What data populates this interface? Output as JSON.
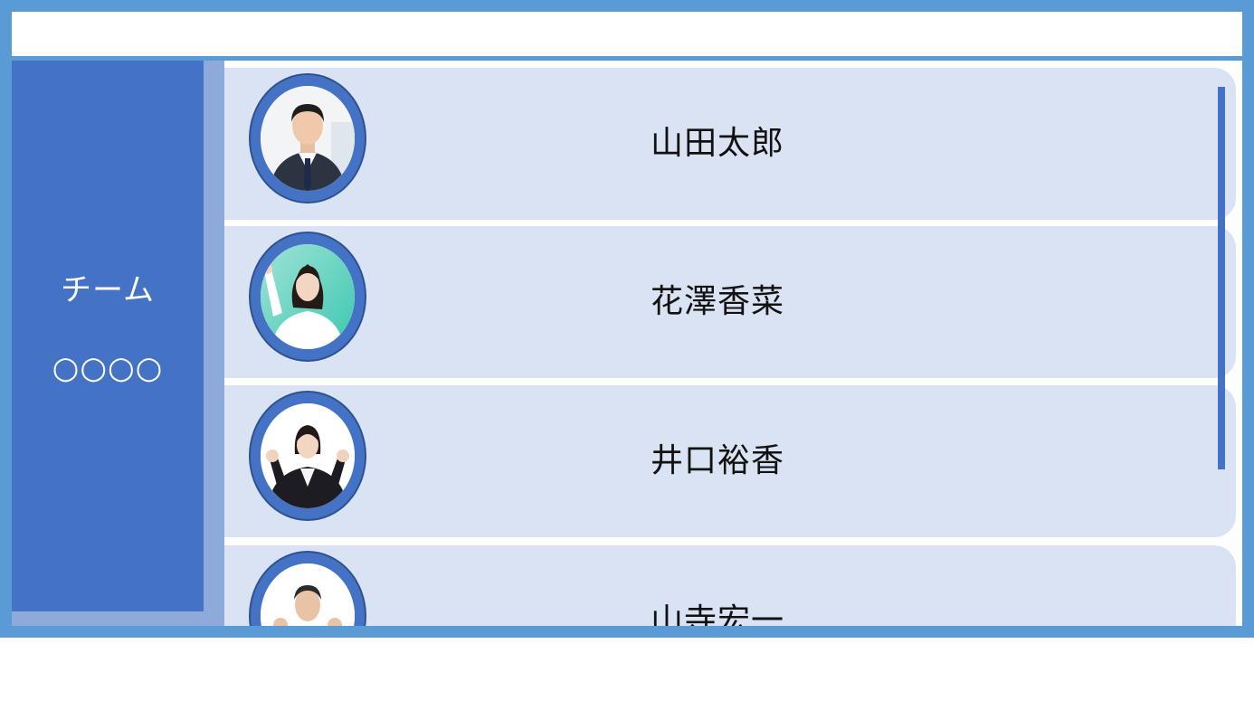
{
  "sidebar": {
    "team_label": "チーム",
    "team_name": "○○○○"
  },
  "members": [
    {
      "name": "山田太郎",
      "avatar_icon": "businessman-photo"
    },
    {
      "name": "花澤香菜",
      "avatar_icon": "businesswoman-cheering-photo"
    },
    {
      "name": "井口裕香",
      "avatar_icon": "businesswoman-fist-pump-photo"
    },
    {
      "name": "山寺宏一",
      "avatar_icon": "businessman-fist-pump-photo"
    }
  ],
  "colors": {
    "frame": "#5b9bd5",
    "sidebar": "#4472c4",
    "sidebar_shadow": "#8eaadb",
    "card": "#dae3f3",
    "scrollbar": "#4472c4"
  }
}
